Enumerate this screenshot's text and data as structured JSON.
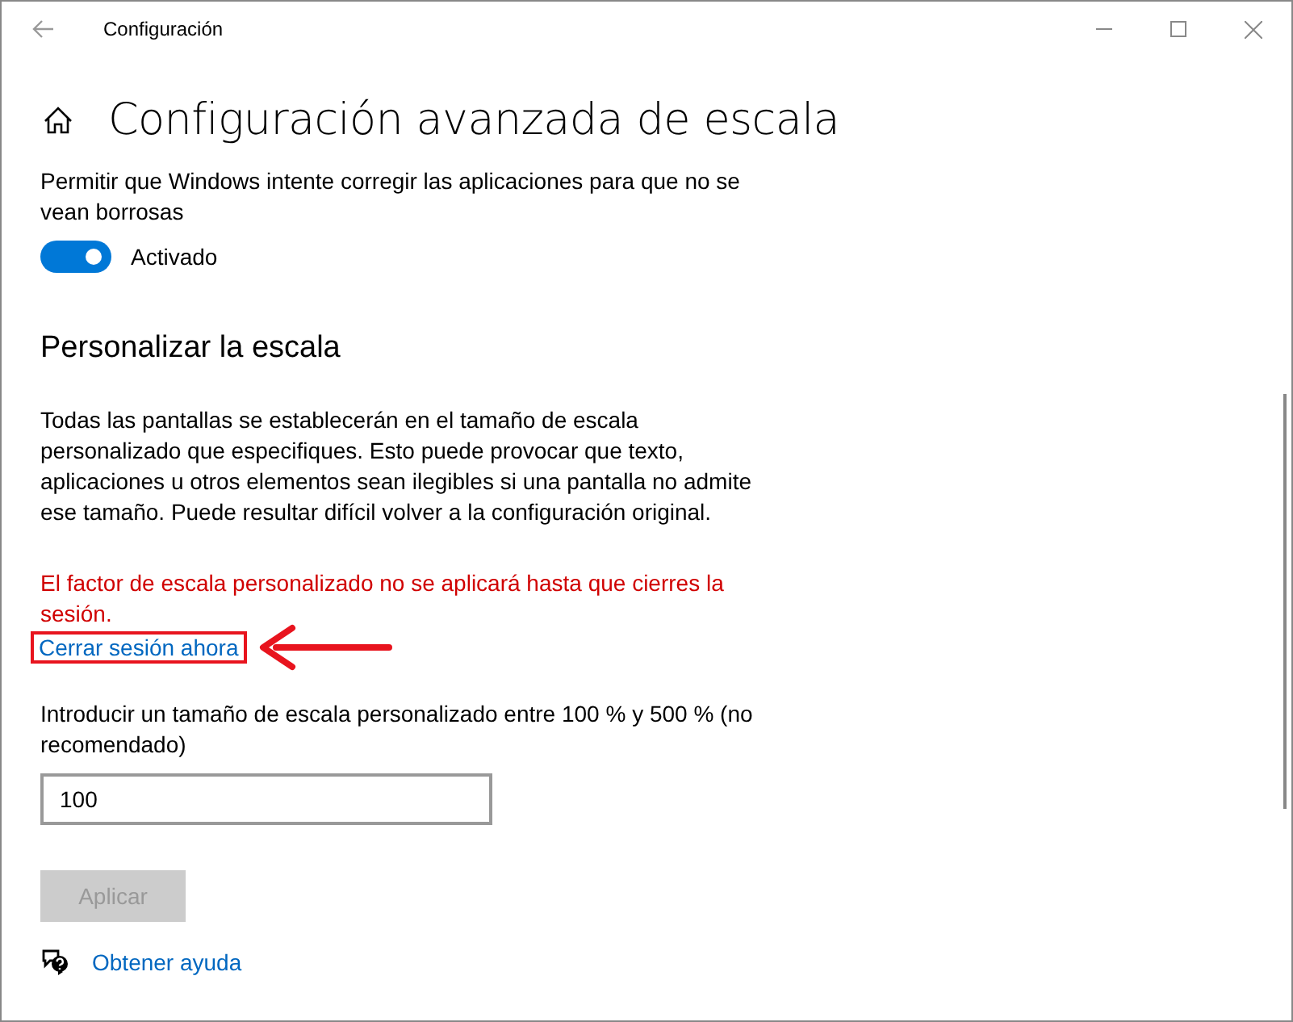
{
  "window": {
    "title": "Configuración"
  },
  "page": {
    "title": "Configuración avanzada de escala"
  },
  "blur_fix": {
    "label": "Permitir que Windows intente corregir las aplicaciones para que no se vean borrosas",
    "on": true,
    "state_text": "Activado"
  },
  "custom_scaling": {
    "heading": "Personalizar la escala",
    "description": "Todas las pantallas se establecerán en el tamaño de escala personalizado que especifiques. Esto puede provocar que texto, aplicaciones u otros elementos sean ilegibles si una pantalla no admite ese tamaño. Puede resultar difícil volver a la configuración original.",
    "warning": "El factor de escala personalizado no se aplicará hasta que cierres la sesión.",
    "signout_link": {
      "label": "Cerrar sesión ahora",
      "highlighted": true
    },
    "input_label": "Introducir un tamaño de escala personalizado entre 100 % y 500 % (no recomendado)",
    "value": "100",
    "apply_button": {
      "label": "Aplicar",
      "disabled": true
    }
  },
  "help_link": "Obtener ayuda"
}
